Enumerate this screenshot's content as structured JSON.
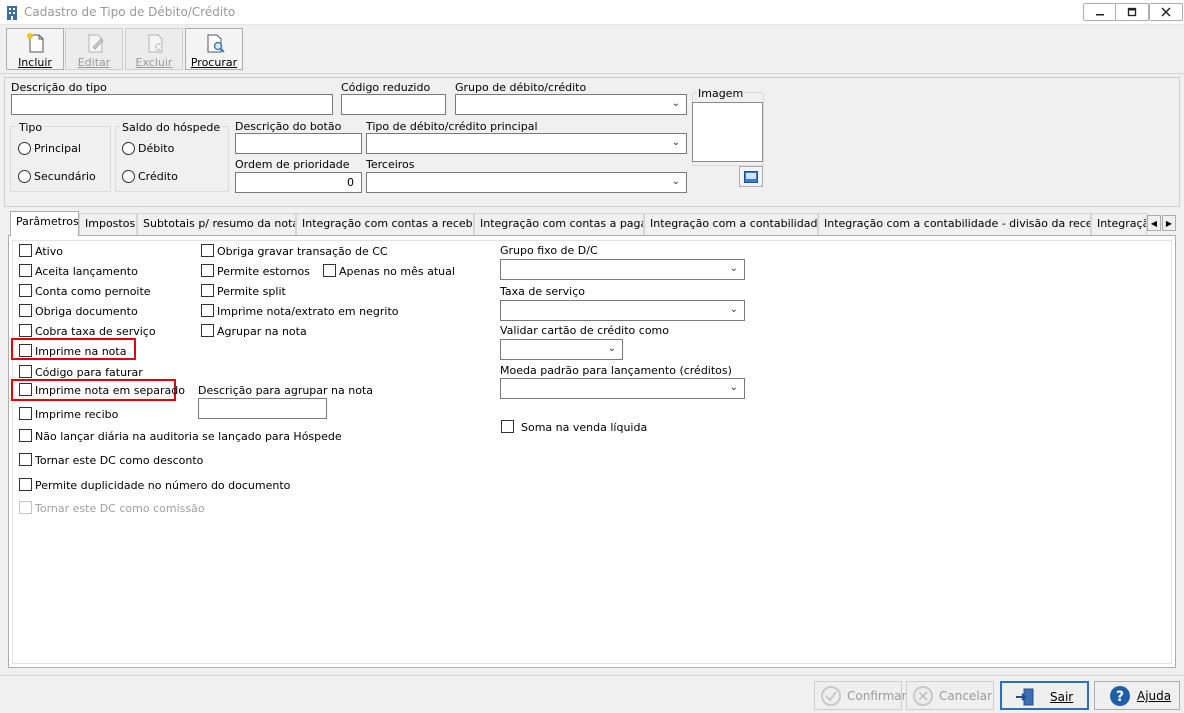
{
  "window": {
    "title": "Cadastro de Tipo de Débito/Crédito"
  },
  "toolbar": {
    "buttons": [
      {
        "label": "Incluir",
        "enabled": true,
        "icon": "new-document-icon"
      },
      {
        "label": "Editar",
        "enabled": false,
        "icon": "edit-document-icon"
      },
      {
        "label": "Excluir",
        "enabled": false,
        "icon": "delete-document-icon"
      },
      {
        "label": "Procurar",
        "enabled": true,
        "icon": "search-document-icon"
      }
    ]
  },
  "header": {
    "descricao_tipo": {
      "label": "Descrição do tipo",
      "value": ""
    },
    "codigo_reduzido": {
      "label": "Código reduzido",
      "value": ""
    },
    "grupo_debito_credito": {
      "label": "Grupo de débito/crédito",
      "value": ""
    },
    "imagem": {
      "label": "Imagem"
    },
    "tipo": {
      "label": "Tipo",
      "options": [
        "Principal",
        "Secundário"
      ],
      "selected": null
    },
    "saldo_hospede": {
      "label": "Saldo do hóspede",
      "options": [
        "Débito",
        "Crédito"
      ],
      "selected": null
    },
    "descricao_botao": {
      "label": "Descrição do botão",
      "value": ""
    },
    "tipo_principal": {
      "label": "Tipo de débito/crédito principal",
      "value": ""
    },
    "ordem_prioridade": {
      "label": "Ordem de prioridade",
      "value": "0"
    },
    "terceiros": {
      "label": "Terceiros",
      "value": ""
    }
  },
  "tabs": [
    {
      "label": "Parâmetros",
      "active": true
    },
    {
      "label": "Impostos"
    },
    {
      "label": "Subtotais p/ resumo da nota"
    },
    {
      "label": "Integração com contas a receber"
    },
    {
      "label": "Integração com contas a pagar"
    },
    {
      "label": "Integração com a contabilidade"
    },
    {
      "label": "Integração com a contabilidade - divisão da receita"
    },
    {
      "label": "Integraçã"
    }
  ],
  "parametros": {
    "col1": [
      {
        "label": "Ativo",
        "checked": false
      },
      {
        "label": "Aceita lançamento",
        "checked": false
      },
      {
        "label": "Conta como pernoite",
        "checked": false
      },
      {
        "label": "Obriga documento",
        "checked": false
      },
      {
        "label": "Cobra taxa de serviço",
        "checked": false
      },
      {
        "label": "Imprime na nota",
        "checked": false,
        "highlighted": true
      },
      {
        "label": "Código para faturar",
        "checked": false
      },
      {
        "label": "Imprime nota em separado",
        "checked": false,
        "highlighted": true
      },
      {
        "label": "Imprime recibo",
        "checked": false
      },
      {
        "label": "Não lançar diária na auditoria se lançado para Hóspede",
        "checked": false
      },
      {
        "label": "Tornar este DC como desconto",
        "checked": false
      },
      {
        "label": "Permite duplicidade no número do documento",
        "checked": false
      },
      {
        "label": "Tornar este DC como comissão",
        "checked": false,
        "enabled": false
      }
    ],
    "col2": [
      {
        "label": "Obriga gravar transação de CC",
        "checked": false
      },
      {
        "label": "Permite estornos",
        "checked": false
      },
      {
        "label": "Permite split",
        "checked": false
      },
      {
        "label": "Imprime nota/extrato em negrito",
        "checked": false
      },
      {
        "label": "Agrupar na nota",
        "checked": false
      }
    ],
    "apenas_mes_atual": {
      "label": "Apenas no mês atual",
      "checked": false
    },
    "descricao_agrupar": {
      "label": "Descrição para agrupar na nota",
      "value": ""
    },
    "col3": {
      "grupo_fixo": {
        "label": "Grupo fixo de D/C",
        "value": ""
      },
      "taxa_servico": {
        "label": "Taxa de serviço",
        "value": ""
      },
      "validar_cartao": {
        "label": "Validar cartão de crédito como",
        "value": ""
      },
      "moeda_padrao": {
        "label": "Moeda padrão para lançamento (créditos)",
        "value": ""
      },
      "soma_venda_liquida": {
        "label": "Soma na venda líquida",
        "checked": false
      }
    }
  },
  "footer": {
    "confirmar": {
      "label": "Confirmar",
      "enabled": false
    },
    "cancelar": {
      "label": "Cancelar",
      "enabled": false
    },
    "sair": {
      "label": "Sair",
      "enabled": true
    },
    "ajuda": {
      "label": "Ajuda",
      "enabled": true
    }
  },
  "colors": {
    "highlight": "#e00000",
    "focus_border": "#2f6fb8",
    "help_icon": "#1f5fa8"
  }
}
